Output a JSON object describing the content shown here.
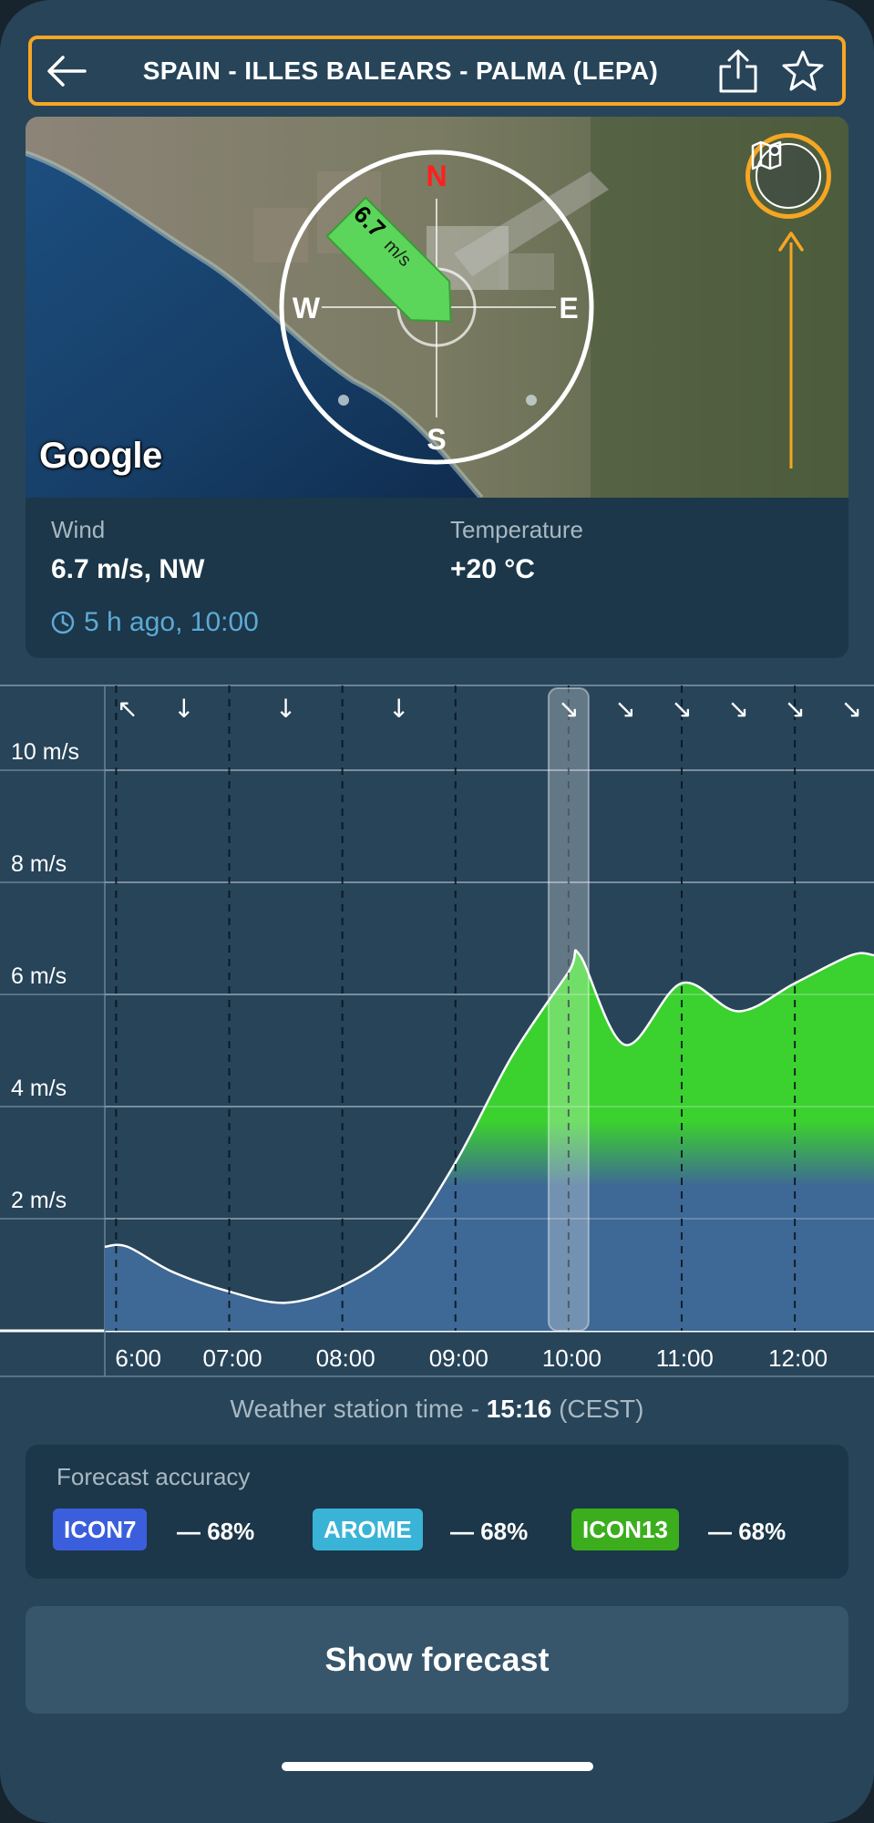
{
  "header": {
    "title": "SPAIN - ILLES BALEARS - PALMA (LEPA)",
    "back_icon": "arrow-left-icon",
    "share_icon": "share-icon",
    "favorite_icon": "star-icon"
  },
  "map": {
    "google_logo": "Google",
    "compass": {
      "north": "N",
      "south": "S",
      "east": "E",
      "west": "W"
    },
    "wind_arrow": {
      "speed": "6.7",
      "unit": "m/s"
    },
    "map_button_icon": "map-pin-icon"
  },
  "info": {
    "wind_label": "Wind",
    "wind_value": "6.7 m/s, NW",
    "temp_label": "Temperature",
    "temp_value": "+20 °C",
    "updated": "5 h ago, 10:00",
    "clock_icon": "clock-icon"
  },
  "chart_data": {
    "type": "area",
    "y_labels": [
      "10 m/s",
      "8 m/s",
      "6 m/s",
      "4 m/s",
      "2 m/s"
    ],
    "ylim": [
      0,
      10
    ],
    "x_labels": [
      "6:00",
      "07:00",
      "08:00",
      "09:00",
      "10:00",
      "11:00",
      "12:00"
    ],
    "xlim": [
      5.9,
      12.7
    ],
    "series": [
      {
        "x": [
          5.9,
          6.1,
          6.5,
          7.0,
          7.5,
          8.0,
          8.5,
          9.0,
          9.5,
          10.0,
          10.1,
          10.5,
          11.0,
          11.5,
          12.0,
          12.5,
          12.7
        ],
        "y": [
          1.5,
          1.5,
          1.05,
          0.7,
          0.5,
          0.8,
          1.5,
          3.0,
          4.9,
          6.4,
          6.7,
          5.1,
          6.2,
          5.7,
          6.2,
          6.7,
          6.7
        ]
      }
    ],
    "direction_arrows": [
      {
        "x": 6.1,
        "dir": "↖"
      },
      {
        "x": 6.6,
        "dir": "↓"
      },
      {
        "x": 7.5,
        "dir": "↓"
      },
      {
        "x": 8.5,
        "dir": "↓"
      },
      {
        "x": 10.0,
        "dir": "↘"
      },
      {
        "x": 10.5,
        "dir": "↘"
      },
      {
        "x": 11.0,
        "dir": "↘"
      },
      {
        "x": 11.5,
        "dir": "↘"
      },
      {
        "x": 12.0,
        "dir": "↘"
      },
      {
        "x": 12.5,
        "dir": "↘"
      }
    ],
    "highlight_x": 10.0,
    "colors": {
      "area_low": "#3e6895",
      "area_high": "#3bd12f",
      "line": "#ffffff"
    },
    "grid": true
  },
  "station": {
    "prefix": "Weather station time - ",
    "time": "15:16",
    "tz": " (CEST)"
  },
  "accuracy": {
    "title": "Forecast accuracy",
    "models": [
      {
        "name": "ICON7",
        "value": "— 68%",
        "color": "#3b5fdc"
      },
      {
        "name": "AROME",
        "value": "— 68%",
        "color": "#3ab4d6"
      },
      {
        "name": "ICON13",
        "value": "— 68%",
        "color": "#3cae1e"
      }
    ]
  },
  "forecast_button": "Show forecast"
}
